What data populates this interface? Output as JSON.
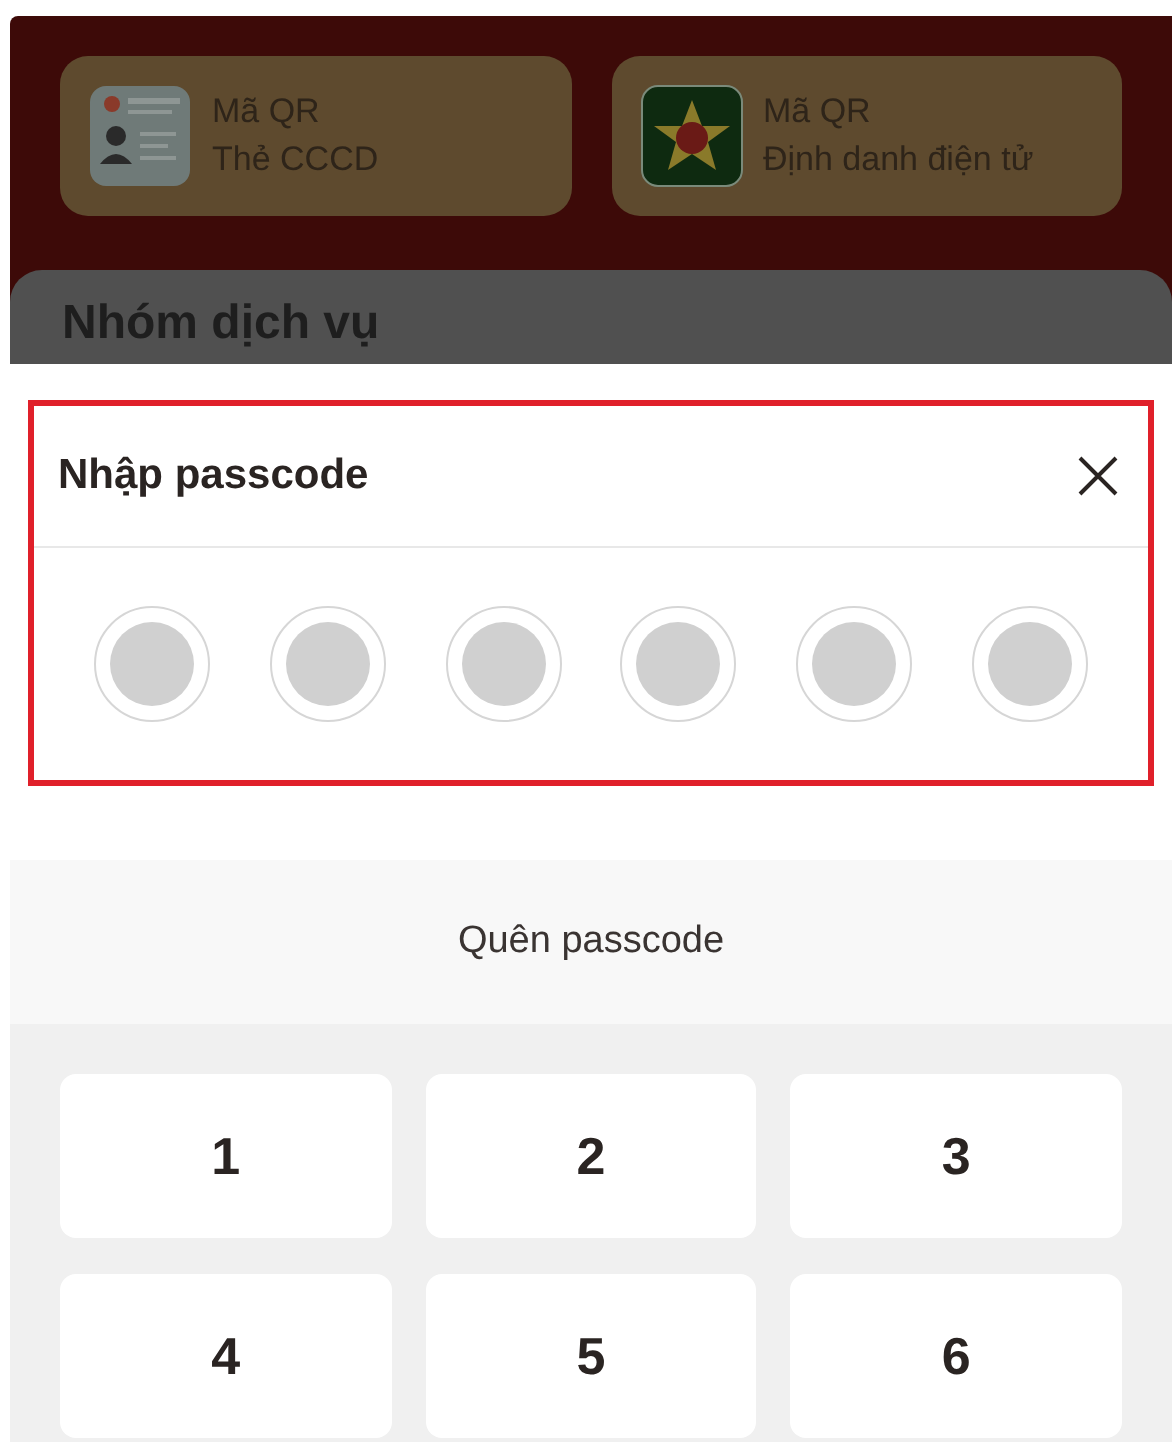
{
  "qr_cards": [
    {
      "kind": "id_card",
      "title": "Mã QR",
      "subtitle": "Thẻ CCCD"
    },
    {
      "kind": "emblem",
      "title": "Mã QR",
      "subtitle": "Định danh điện tử"
    }
  ],
  "section_title": "Nhóm dịch vụ",
  "passcode_sheet": {
    "title": "Nhập passcode",
    "dots": [
      {
        "filled": false
      },
      {
        "filled": false
      },
      {
        "filled": false
      },
      {
        "filled": false
      },
      {
        "filled": false
      },
      {
        "filled": false
      }
    ],
    "forgot_link": "Quên passcode",
    "keys": [
      "1",
      "2",
      "3",
      "4",
      "5",
      "6"
    ]
  }
}
